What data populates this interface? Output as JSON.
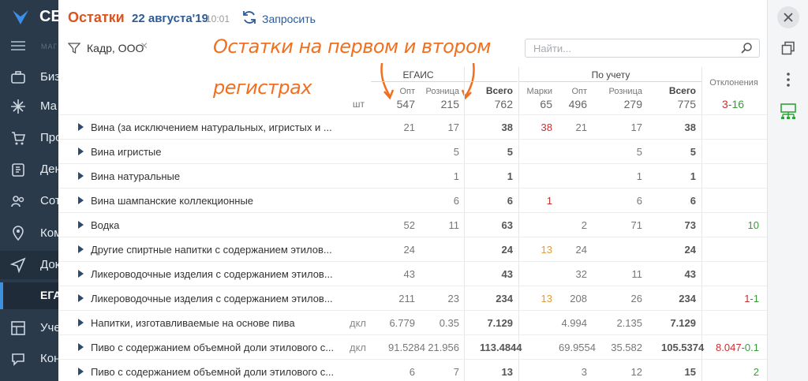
{
  "sidebar": {
    "brand": "СЕ",
    "small_label": "МАГ",
    "items": [
      {
        "label": "Биз",
        "icon": "briefcase-icon"
      },
      {
        "label": "Ма",
        "icon": "sparkle-icon"
      },
      {
        "label": "Про",
        "icon": "cart-icon"
      },
      {
        "label": "Ден",
        "icon": "money-icon"
      },
      {
        "label": "Сот",
        "icon": "users-icon"
      },
      {
        "label": "Ком",
        "icon": "location-icon"
      },
      {
        "label": "Док",
        "icon": "send-icon"
      },
      {
        "label": "Уче",
        "icon": "grid-icon"
      },
      {
        "label": "Кон",
        "icon": "chat-icon"
      }
    ],
    "sub_item": "ЕГА"
  },
  "header": {
    "title": "Остатки",
    "date": "22 августа'19",
    "time": "10:01",
    "request_label": "Запросить"
  },
  "filter": {
    "text": "Кадр, ООО"
  },
  "search": {
    "placeholder": "Найти..."
  },
  "annotation": {
    "line1": "Остатки на первом и втором",
    "line2": "регистрах"
  },
  "table": {
    "groups": {
      "egais": "ЕГАИС",
      "accounting": "По учету",
      "deviations": "Отклонения"
    },
    "unit_header": "шт",
    "columns": {
      "opt": "Опт",
      "retail": "Розница",
      "total": "Всего",
      "marks": "Марки",
      "opt2": "Опт",
      "retail2": "Розница",
      "total2": "Всего"
    },
    "totals": {
      "opt": "547",
      "retail": "215",
      "total": "762",
      "marks": "65",
      "opt2": "496",
      "retail2": "279",
      "total2": "775",
      "dev_neg": "3",
      "dev_sep": "-",
      "dev_pos": "16"
    },
    "rows": [
      {
        "name": "Вина (за исключением натуральных, игристых и ...",
        "unit": "",
        "opt": "21",
        "retail": "17",
        "total": "38",
        "marks": "38",
        "marks_color": "red",
        "opt2": "21",
        "retail2": "17",
        "total2": "38",
        "dev_neg": "",
        "dev_pos": ""
      },
      {
        "name": "Вина игристые",
        "unit": "",
        "opt": "",
        "retail": "5",
        "total": "5",
        "marks": "",
        "marks_color": "",
        "opt2": "",
        "retail2": "5",
        "total2": "5",
        "dev_neg": "",
        "dev_pos": ""
      },
      {
        "name": "Вина натуральные",
        "unit": "",
        "opt": "",
        "retail": "1",
        "total": "1",
        "marks": "",
        "marks_color": "",
        "opt2": "",
        "retail2": "1",
        "total2": "1",
        "dev_neg": "",
        "dev_pos": ""
      },
      {
        "name": "Вина шампанские коллекционные",
        "unit": "",
        "opt": "",
        "retail": "6",
        "total": "6",
        "marks": "1",
        "marks_color": "red",
        "opt2": "",
        "retail2": "6",
        "total2": "6",
        "dev_neg": "",
        "dev_pos": ""
      },
      {
        "name": "Водка",
        "unit": "",
        "opt": "52",
        "retail": "11",
        "total": "63",
        "marks": "",
        "marks_color": "",
        "opt2": "2",
        "retail2": "71",
        "total2": "73",
        "dev_neg": "",
        "dev_pos": "10"
      },
      {
        "name": "Другие спиртные напитки с содержанием этилов...",
        "unit": "",
        "opt": "24",
        "retail": "",
        "total": "24",
        "marks": "13",
        "marks_color": "orange",
        "opt2": "24",
        "retail2": "",
        "total2": "24",
        "dev_neg": "",
        "dev_pos": ""
      },
      {
        "name": "Ликероводочные изделия с содержанием этилов...",
        "unit": "",
        "opt": "43",
        "retail": "",
        "total": "43",
        "marks": "",
        "marks_color": "",
        "opt2": "32",
        "retail2": "11",
        "total2": "43",
        "dev_neg": "",
        "dev_pos": ""
      },
      {
        "name": "Ликероводочные изделия с содержанием этилов...",
        "unit": "",
        "opt": "211",
        "retail": "23",
        "total": "234",
        "marks": "13",
        "marks_color": "orange",
        "opt2": "208",
        "retail2": "26",
        "total2": "234",
        "dev_neg": "1",
        "dev_pos": "1"
      },
      {
        "name": "Напитки, изготавливаемые на основе пива",
        "unit": "дкл",
        "opt": "6.779",
        "retail": "0.35",
        "total": "7.129",
        "marks": "",
        "marks_color": "",
        "opt2": "4.994",
        "retail2": "2.135",
        "total2": "7.129",
        "dev_neg": "",
        "dev_pos": ""
      },
      {
        "name": "Пиво с содержанием объемной доли этилового с...",
        "unit": "дкл",
        "opt": "91.5284",
        "retail": "21.956",
        "total": "113.4844",
        "marks": "",
        "marks_color": "",
        "opt2": "69.9554",
        "retail2": "35.582",
        "total2": "105.5374",
        "dev_neg": "8.047",
        "dev_pos": "0.1"
      },
      {
        "name": "Пиво с содержанием объемной доли этилового с...",
        "unit": "",
        "opt": "6",
        "retail": "7",
        "total": "13",
        "marks": "",
        "marks_color": "",
        "opt2": "3",
        "retail2": "12",
        "total2": "15",
        "dev_neg": "",
        "dev_pos": "2"
      }
    ]
  }
}
